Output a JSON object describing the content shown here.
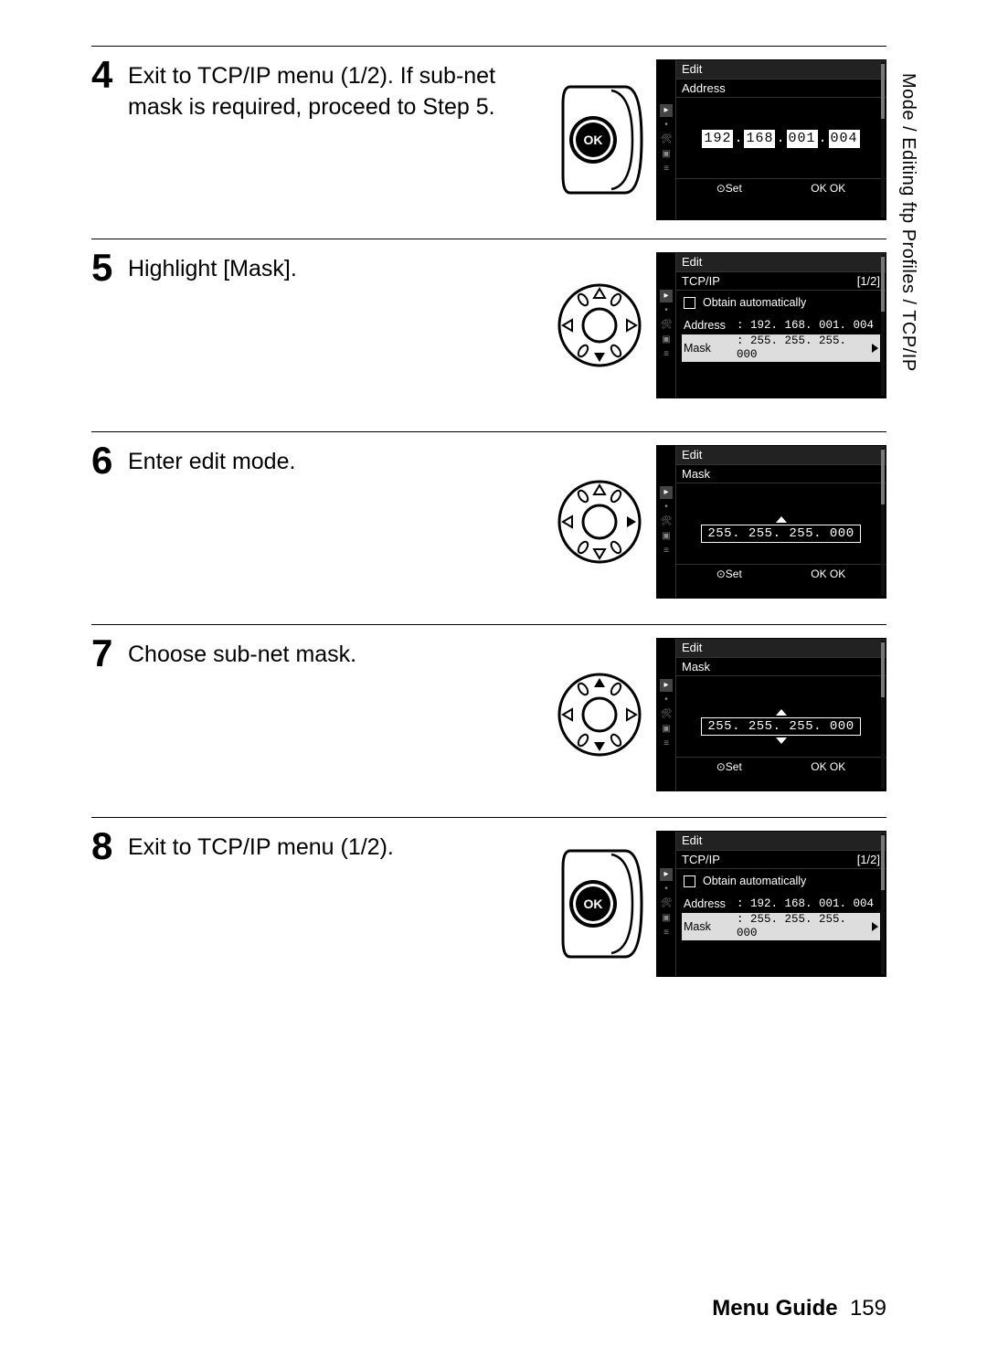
{
  "sideTab": "Mode / Editing ftp Profiles / TCP/IP",
  "footer": {
    "label": "Menu Guide",
    "page": "159"
  },
  "okLabel": "OK",
  "steps": [
    {
      "num": "4",
      "text": "Exit to TCP/IP menu (1/2).  If sub-net mask is required, proceed to Step 5.",
      "control": "ok",
      "screen": "address_edit"
    },
    {
      "num": "5",
      "text": "Highlight [Mask].",
      "control": "dpad_down",
      "screen": "tcpip_mask_hl"
    },
    {
      "num": "6",
      "text": "Enter edit mode.",
      "control": "dpad_right",
      "screen": "mask_edit_up"
    },
    {
      "num": "7",
      "text": "Choose sub-net mask.",
      "control": "dpad_updown",
      "screen": "mask_edit_updown"
    },
    {
      "num": "8",
      "text": "Exit to TCP/IP menu (1/2).",
      "control": "ok",
      "screen": "tcpip_mask_hl"
    }
  ],
  "screens": {
    "address_edit": {
      "title": "Edit",
      "subtitle": "Address",
      "ip_groups": [
        "192",
        "168",
        "001",
        "004"
      ],
      "foot_set": "⊙Set",
      "foot_ok": "OK OK"
    },
    "tcpip_mask_hl": {
      "title": "Edit",
      "subtitle": "TCP/IP",
      "page": "[1/2]",
      "obtain": "Obtain automatically",
      "addr_label": "Address",
      "addr_val": ": 192. 168. 001. 004",
      "mask_label": "Mask",
      "mask_val": ": 255. 255. 255. 000"
    },
    "mask_edit_up": {
      "title": "Edit",
      "subtitle": "Mask",
      "value": "255. 255. 255. 000",
      "foot_set": "⊙Set",
      "foot_ok": "OK OK"
    },
    "mask_edit_updown": {
      "title": "Edit",
      "subtitle": "Mask",
      "value": "255. 255. 255. 000",
      "foot_set": "⊙Set",
      "foot_ok": "OK OK"
    }
  }
}
